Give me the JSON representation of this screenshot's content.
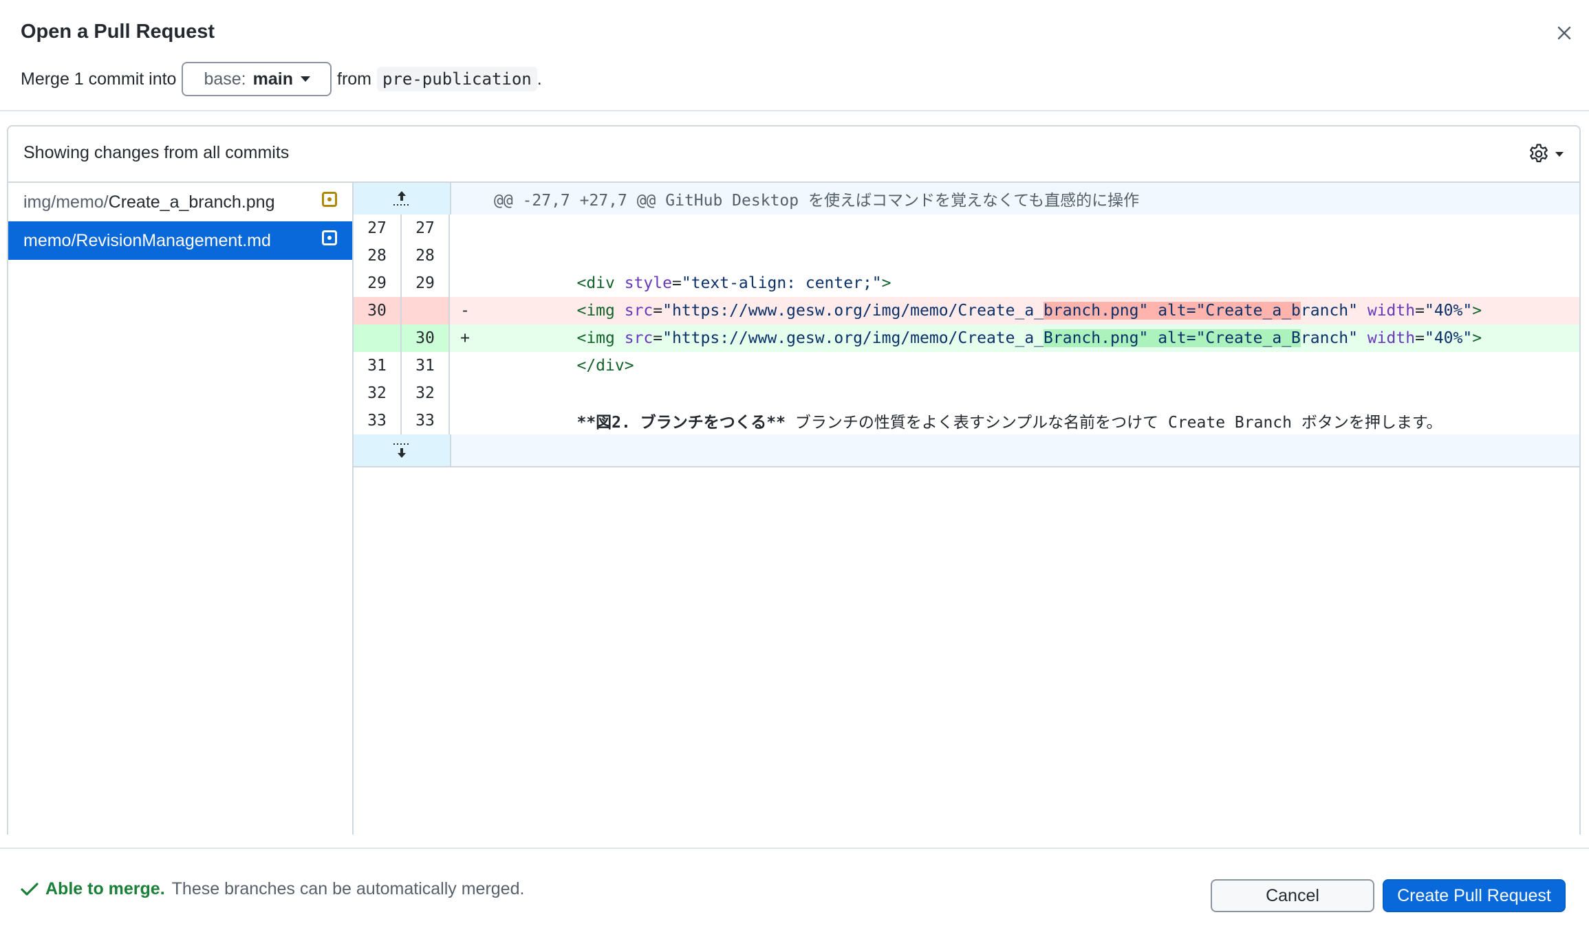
{
  "dialog": {
    "title": "Open a Pull Request",
    "merge_prefix": "Merge 1 commit into",
    "base_label": "base:",
    "base_value": "main",
    "from_label": "from",
    "head_branch": "pre-publication",
    "period": "."
  },
  "panel": {
    "heading": "Showing changes from all commits"
  },
  "files": [
    {
      "dir": "img/memo/",
      "name": "Create_a_branch.png",
      "selected": false
    },
    {
      "dir": "",
      "name": "memo/RevisionManagement.md",
      "selected": true
    }
  ],
  "diff": {
    "hunk_header": "@@ -27,7 +27,7 @@ GitHub Desktop を使えばコマンドを覚えなくても直感的に操作",
    "lines": [
      {
        "old": "27",
        "new": "27",
        "marker": ""
      },
      {
        "old": "28",
        "new": "28",
        "marker": ""
      },
      {
        "old": "29",
        "new": "29",
        "marker": "",
        "tag_open": "<div",
        "attr1": "style",
        "eq1": "=",
        "val1": "\"text-align: center;\"",
        "tag_close": ">"
      },
      {
        "old": "30",
        "new": "",
        "marker": "-",
        "tag_open": "<img",
        "attr1": "src",
        "eq1": "=",
        "val1a": "\"https://www.gesw.org/img/memo/Create_a_",
        "val1b": "branch.png\" alt=\"Create_a_b",
        "val1c": "ranch\"",
        "attr2": "width",
        "val2": "\"40%\"",
        "tag_close": ">"
      },
      {
        "old": "",
        "new": "30",
        "marker": "+",
        "tag_open": "<img",
        "attr1": "src",
        "eq1": "=",
        "val1a": "\"https://www.gesw.org/img/memo/Create_a_",
        "val1b": "Branch.png\" alt=\"Create_a_B",
        "val1c": "ranch\"",
        "attr2": "width",
        "val2": "\"40%\"",
        "tag_close": ">"
      },
      {
        "old": "31",
        "new": "31",
        "marker": "",
        "text": "</div>"
      },
      {
        "old": "32",
        "new": "32",
        "marker": ""
      },
      {
        "old": "33",
        "new": "33",
        "marker": "",
        "bold": "**図2. ブランチをつくる**",
        "text": " ブランチの性質をよく表すシンプルな名前をつけて Create Branch ボタンを押します。"
      }
    ]
  },
  "footer": {
    "status_ok": "Able to merge.",
    "status_desc": "These branches can be automatically merged.",
    "cancel_label": "Cancel",
    "create_label": "Create Pull Request"
  },
  "icons": {
    "close": "close-icon",
    "caret": "caret-down-icon",
    "gear": "gear-icon",
    "modified": "file-modified-icon",
    "expand_up": "expand-up-icon",
    "expand_down": "expand-down-icon",
    "check": "check-icon"
  },
  "colors": {
    "accent": "#0969da",
    "success": "#1a7f37",
    "modified": "#b08800",
    "deleted_bg": "#ffebe9",
    "added_bg": "#e6ffec"
  }
}
